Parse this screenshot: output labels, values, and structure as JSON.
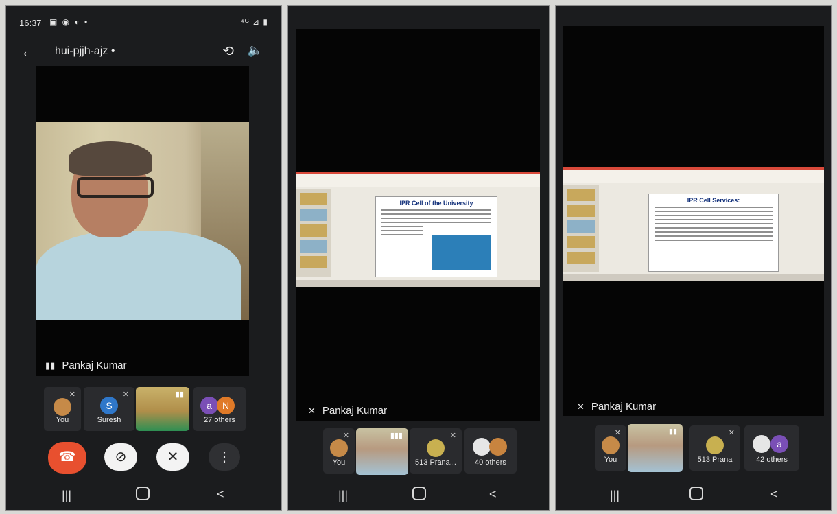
{
  "status": {
    "time": "16:37",
    "icons": "▣ ◉ ◐ •",
    "right": "⁴ᴳ ⊿ ▮"
  },
  "topbar": {
    "meeting_code": "hui-pjjh-ajz •"
  },
  "screens": [
    {
      "speaker_name": "Pankaj Kumar",
      "tiles": [
        {
          "label": "You"
        },
        {
          "label": "Suresh",
          "initial": "S"
        },
        {
          "label": ""
        },
        {
          "label": "27 others",
          "initials": [
            "a",
            "N"
          ]
        }
      ]
    },
    {
      "speaker_name": "Pankaj Kumar",
      "slide_title": "IPR Cell of the University",
      "tiles": [
        {
          "label": "You"
        },
        {
          "label": ""
        },
        {
          "label": "513 Prana..."
        },
        {
          "label": "40 others"
        }
      ]
    },
    {
      "speaker_name": "Pankaj Kumar",
      "slide_title": "IPR Cell Services:",
      "tiles": [
        {
          "label": "You"
        },
        {
          "label": ""
        },
        {
          "label": "513 Prana"
        },
        {
          "label": "42 others",
          "initial": "a"
        }
      ]
    }
  ],
  "colors": {
    "end_call": "#e8502f",
    "suresh_avatar": "#2f77c9",
    "purple_avatar": "#7a4fb6",
    "orange_avatar": "#e07a28"
  }
}
